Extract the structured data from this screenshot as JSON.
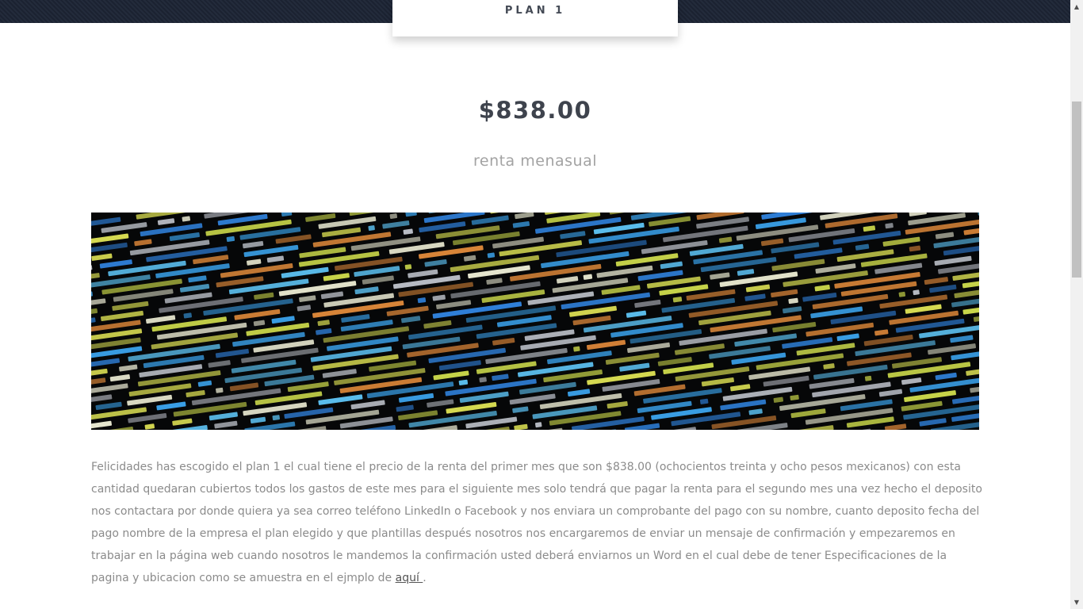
{
  "header": {
    "plan_tab_label": "PLAN 1"
  },
  "pricing": {
    "price": "$838.00",
    "caption": "renta menasual"
  },
  "hero_image": {
    "description": "code-screenshot-image"
  },
  "description": {
    "text": "Felicidades has escogido el plan 1 el cual tiene el precio de la renta del primer mes que son $838.00 (ochocientos treinta y ocho pesos mexicanos) con esta cantidad quedaran cubiertos todos los gastos de este mes para el siguiente mes solo tendrá que pagar la renta para el segundo mes una vez hecho el deposito nos contactara por donde quiera ya sea correo teléfono LinkedIn o Facebook y nos enviara un comprobante del pago con su nombre, cuanto deposito fecha del pago nombre de la empresa el plan elegido y que plantillas después nosotros nos encargaremos de enviar un mensaje de confirmación y empezaremos en trabajar en la página web cuando nosotros le mandemos la confirmación usted deberá enviarnos un Word en el cual debe de tener Especificaciones de la pagina y ubicacion como se amuestra en el ejmplo de",
    "link_label": "aquí ",
    "trailing": "."
  },
  "colors": {
    "top_bar": "#232b3b",
    "price_text": "#3e434d",
    "caption_text": "#a3a3a3",
    "body_text": "#8b8b8b"
  }
}
